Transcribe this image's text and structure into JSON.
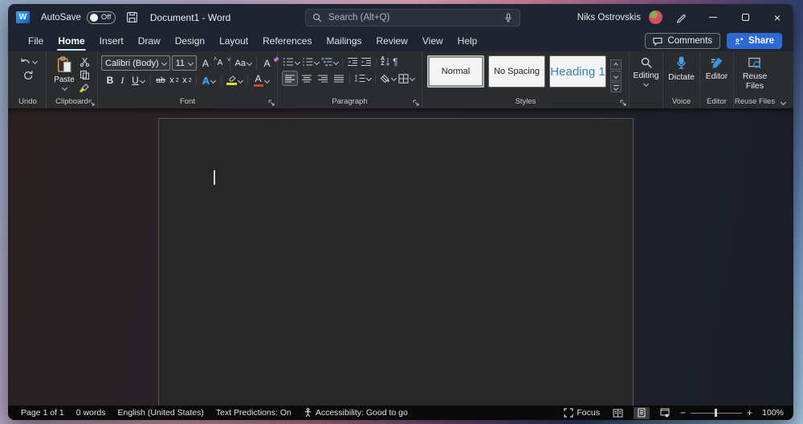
{
  "window": {
    "logo_letter": "W",
    "autosave_label": "AutoSave",
    "autosave_state": "Off",
    "title": "Document1 - Word",
    "search_placeholder": "Search (Alt+Q)",
    "user_name": "Niks Ostrovskis",
    "close_glyph": "×"
  },
  "menu": {
    "tabs": [
      {
        "label": "File"
      },
      {
        "label": "Home",
        "active": true
      },
      {
        "label": "Insert"
      },
      {
        "label": "Draw"
      },
      {
        "label": "Design"
      },
      {
        "label": "Layout"
      },
      {
        "label": "References"
      },
      {
        "label": "Mailings"
      },
      {
        "label": "Review"
      },
      {
        "label": "View"
      },
      {
        "label": "Help"
      }
    ],
    "comments_label": "Comments",
    "share_label": "Share"
  },
  "ribbon": {
    "undo": {
      "label": "Undo"
    },
    "clipboard": {
      "label": "Clipboard",
      "paste_label": "Paste"
    },
    "font": {
      "label": "Font",
      "family": "Calibri (Body)",
      "size": "11",
      "grow_letter": "A",
      "shrink_letter": "A",
      "case_label": "Aa",
      "clear_letter": "A",
      "bold": "B",
      "italic": "I",
      "underline": "U",
      "strikethrough": "ab",
      "sub_base": "x",
      "sub_script": "2",
      "sup_base": "x",
      "sup_script": "2",
      "effects_letter": "A",
      "color_letter": "A"
    },
    "paragraph": {
      "label": "Paragraph",
      "sort_a": "A",
      "sort_z": "Z",
      "pilcrow": "¶"
    },
    "styles": {
      "label": "Styles",
      "items": [
        "Normal",
        "No Spacing",
        "Heading 1"
      ]
    },
    "editing": {
      "label": "Editing"
    },
    "voice": {
      "label": "Voice",
      "dictate_label": "Dictate"
    },
    "editor": {
      "label": "Editor",
      "button_label": "Editor"
    },
    "reuse": {
      "label": "Reuse Files",
      "button_label": "Reuse Files"
    }
  },
  "statusbar": {
    "page_info": "Page 1 of 1",
    "word_count": "0 words",
    "language": "English (United States)",
    "predictions": "Text Predictions: On",
    "accessibility": "Accessibility: Good to go",
    "focus_label": "Focus",
    "zoom_minus": "−",
    "zoom_plus": "+",
    "zoom_level": "100%"
  },
  "colors": {
    "share_accent": "#2b6bd3",
    "heading1_blue": "#3f7fb5",
    "highlight_yellow": "#e8df3c",
    "font_color_red": "#d83b3b",
    "dictate_blue": "#4a9edb",
    "home_tab_underline": "#cfe0f2"
  }
}
